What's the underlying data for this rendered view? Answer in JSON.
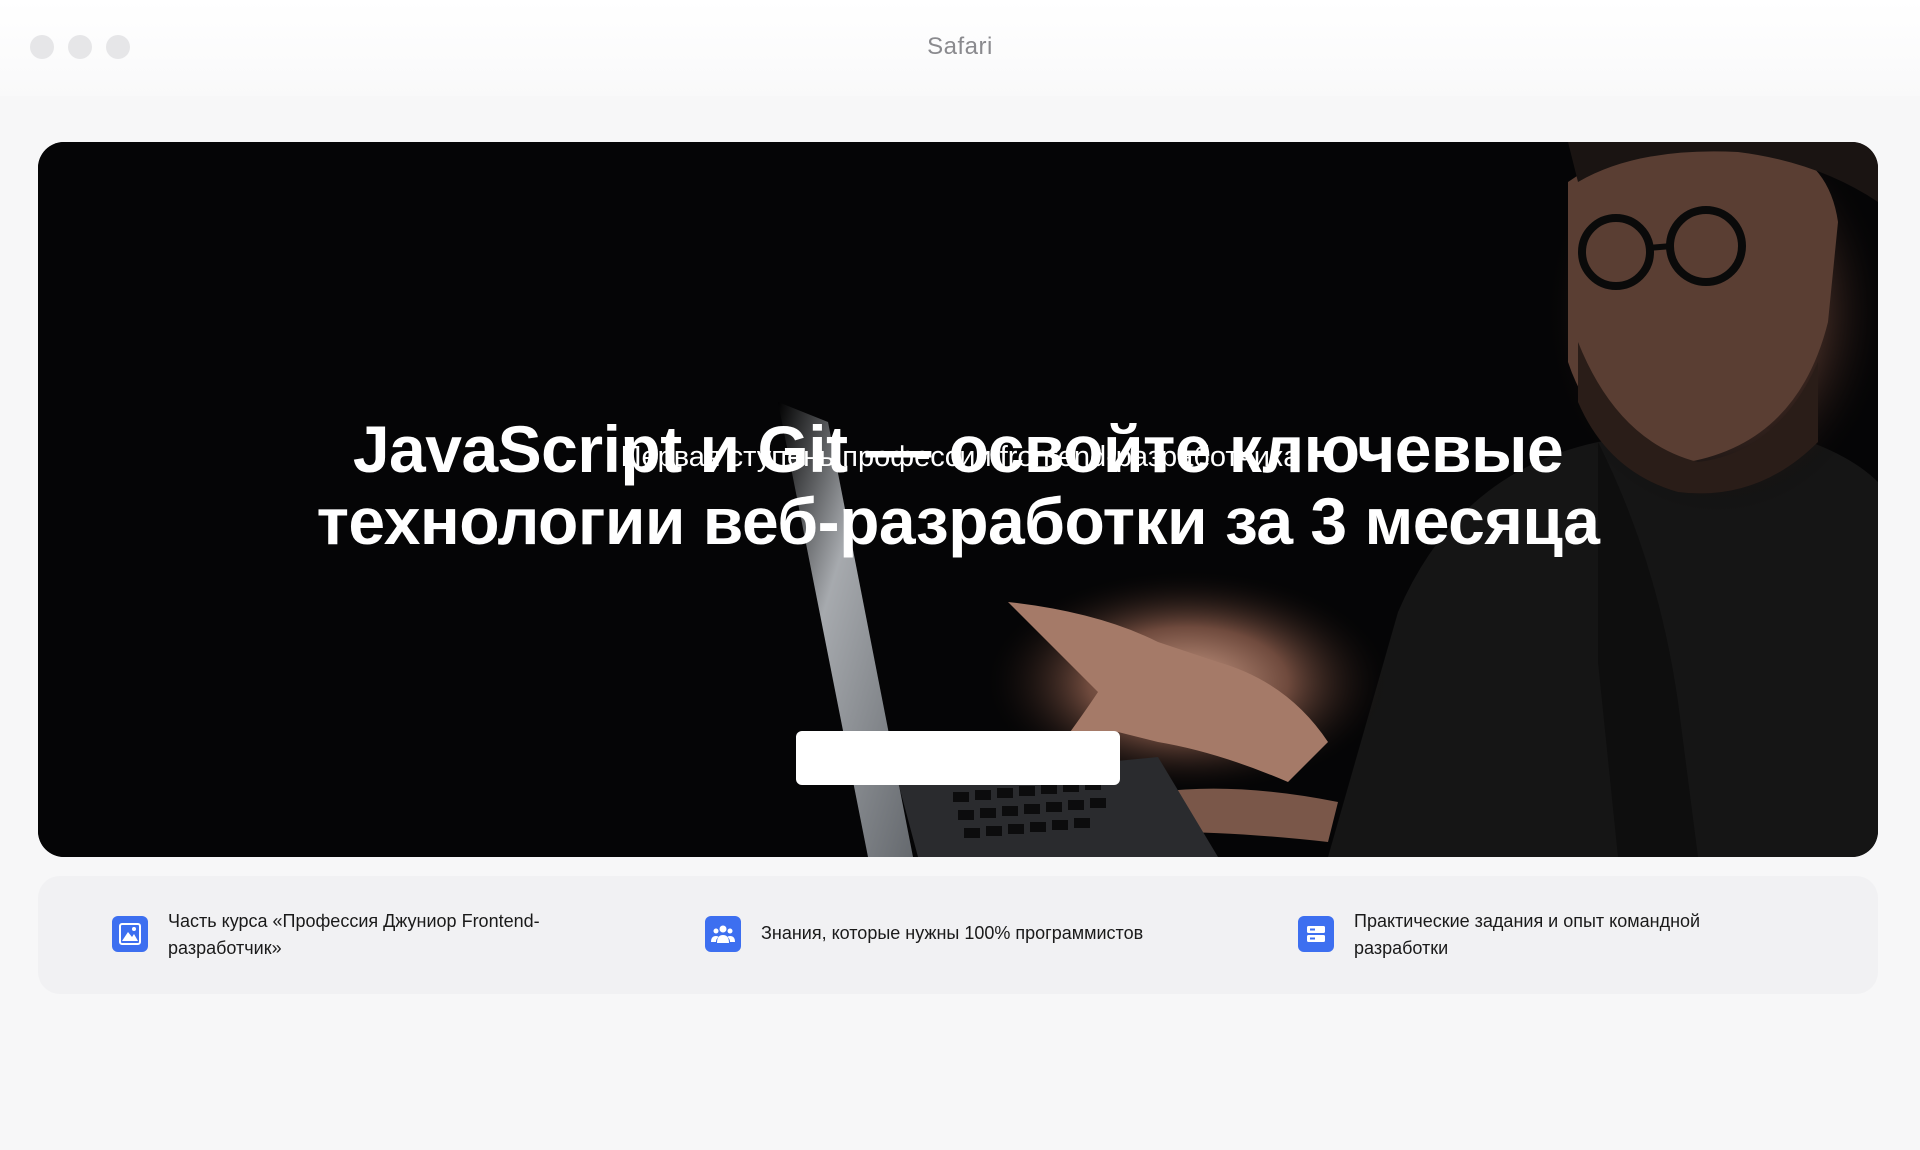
{
  "window": {
    "title": "Safari"
  },
  "hero": {
    "title_line1": "JavaScript и Git — освойте ключевые",
    "title_line2": "технологии веб-разработки за 3 месяца",
    "subtitle": "Первая ступень профессии frontend-разработчика",
    "cta_label": ""
  },
  "features": [
    {
      "icon": "image-icon",
      "text": "Часть курса «Профессия Джуниор Frontend-разработчик»"
    },
    {
      "icon": "people-icon",
      "text": "Знания, которые нужны 100% программистов"
    },
    {
      "icon": "server-icon",
      "text": "Практические задания и опыт командной разработки"
    }
  ],
  "colors": {
    "accent": "#3d6ff0",
    "hero_background": "#050506",
    "page_background": "#f7f7f8"
  }
}
